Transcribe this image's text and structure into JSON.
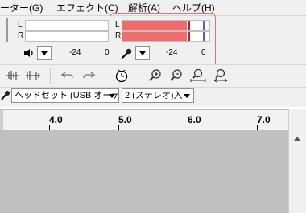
{
  "menubar": {
    "items": [
      "ーター(G)",
      "エフェクト(C)",
      "解析(A)",
      "ヘルプ(H)"
    ]
  },
  "playback_meter": {
    "channels": [
      "L",
      "R"
    ],
    "scale_labels": [
      "-24",
      "0"
    ],
    "volume_icon": "speaker-icon"
  },
  "recording_meter": {
    "channels": [
      "L",
      "R"
    ],
    "scale_labels": [
      "-24",
      "0"
    ],
    "level": {
      "L": 0.74,
      "R": 0.74
    },
    "peak_color": "#e57373",
    "level_color": "#f06b6b",
    "input_icon": "microphone-icon"
  },
  "device_toolbar": {
    "input_device": "ヘッドセット (USB オーテ",
    "channels": "2 (ステレオ)入"
  },
  "timeline": {
    "labels": [
      "4.0",
      "5.0",
      "6.0",
      "7.0"
    ]
  },
  "colors": {
    "highlight_outline": "#e57373",
    "track_background": "#c0c0c0"
  }
}
